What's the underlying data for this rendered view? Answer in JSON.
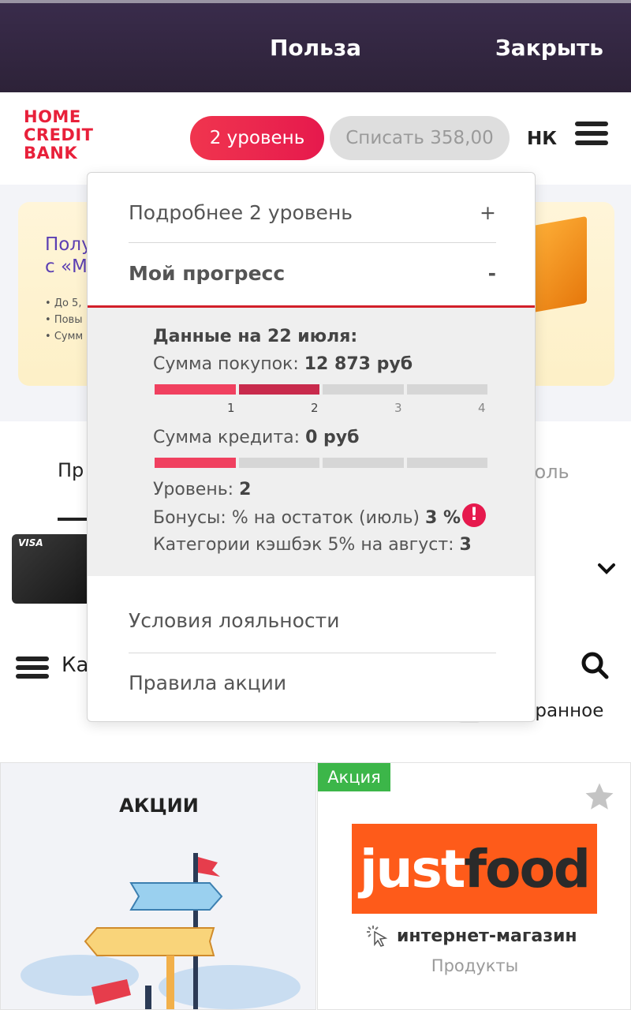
{
  "topbar": {
    "title": "Польза",
    "close_label": "Закрыть"
  },
  "header": {
    "logo_lines": [
      "HOME",
      "CREDIT",
      "BANK"
    ],
    "level_label": "2 уровень",
    "spend_label": "Списать 358,00",
    "initials": "НК"
  },
  "banner": {
    "title_lines": [
      "Полу",
      "с «М"
    ],
    "bullets": [
      "До 5,",
      "Повы",
      "Сумм"
    ]
  },
  "tabs": {
    "left": "Пр",
    "right": "юль"
  },
  "card": {
    "brand": "VISA"
  },
  "catalog": {
    "label": "Ка",
    "favorites_label": "избранное"
  },
  "promo_tile": {
    "title": "АКЦИИ"
  },
  "shop_tile": {
    "badge": "Акция",
    "logo_part1": "just",
    "logo_part2": "food",
    "type": "интернет-магазин",
    "category": "Продукты"
  },
  "dropdown": {
    "item_more": {
      "label": "Подробнее 2 уровень",
      "sign": "+"
    },
    "item_progress": {
      "label": "Мой прогресс",
      "sign": "-"
    },
    "progress": {
      "date_label": "Данные на 22 июля:",
      "purchases_label": "Сумма покупок:",
      "purchases_value": "12 873 руб",
      "purchases_level": 2,
      "ticks": [
        "1",
        "2",
        "3",
        "4"
      ],
      "credit_label": "Сумма кредита:",
      "credit_value": "0 руб",
      "credit_level": 1,
      "level_label": "Уровень:",
      "level_value": "2",
      "bonus_label": "Бонусы: % на остаток (июль)",
      "bonus_value": "3 %",
      "cashback_label": "Категории кэшбэк 5% на август:",
      "cashback_value": "3"
    },
    "item_loyalty": "Условия лояльности",
    "item_rules": "Правила акции"
  },
  "colors": {
    "accent": "#e8203a",
    "bar_1": "#f0405f",
    "bar_2": "#c82a4c",
    "bar_empty": "#d6d6d6",
    "promo_green": "#3cb649",
    "justfood_orange": "#fe5b1a"
  }
}
